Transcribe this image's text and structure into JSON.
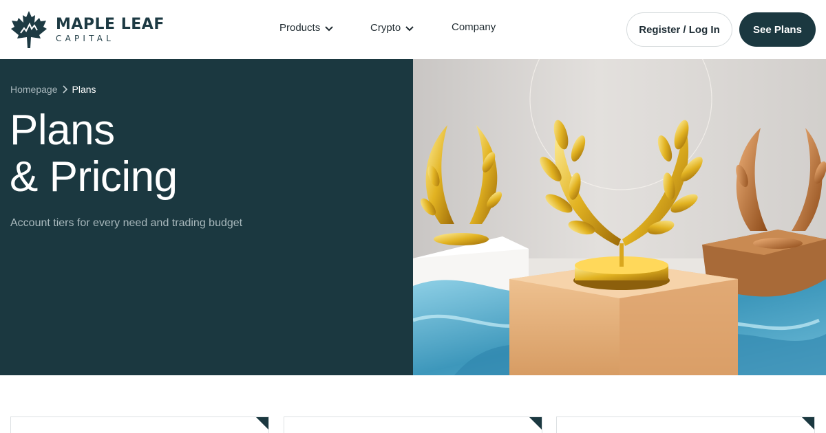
{
  "brand": {
    "name": "MAPLE LEAF",
    "tagline": "CAPITAL",
    "logo_icon": "maple-leaf-icon",
    "primary_color": "#1b3840"
  },
  "nav": {
    "items": [
      {
        "label": "Products",
        "has_dropdown": true
      },
      {
        "label": "Crypto",
        "has_dropdown": true
      },
      {
        "label": "Company",
        "has_dropdown": false
      }
    ]
  },
  "actions": {
    "register_label": "Register / Log In",
    "plans_label": "See Plans"
  },
  "hero": {
    "breadcrumb": {
      "home": "Homepage",
      "current": "Plans"
    },
    "title_line1": "Plans",
    "title_line2": "& Pricing",
    "subtitle": "Account tiers for every need and trading budget",
    "image_subject": "gold-laurel-wreath-trophies"
  },
  "cards": {
    "count": 3,
    "accent_color": "#1b3840"
  }
}
